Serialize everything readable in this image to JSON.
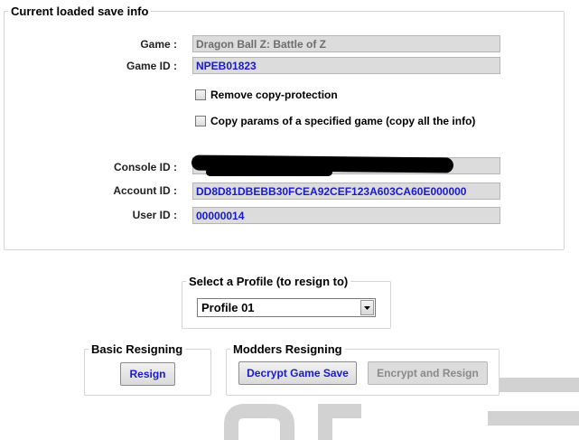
{
  "save_info": {
    "legend": "Current loaded save info",
    "game_label": "Game :",
    "game_value": "Dragon Ball Z: Battle of Z",
    "game_id_label": "Game ID :",
    "game_id_value": "NPEB01823",
    "remove_copy_protection_label": "Remove copy-protection",
    "copy_params_label": "Copy params of a specified game (copy all the info)",
    "console_id_label": "Console ID :",
    "account_id_label": "Account ID :",
    "account_id_value": "DD8D81DBEBB30FCEA92CEF123A603CA60E000000",
    "user_id_label": "User ID :",
    "user_id_value": "00000014"
  },
  "profile": {
    "legend": "Select a Profile (to resign to)",
    "selected": "Profile 01"
  },
  "basic": {
    "legend": "Basic Resigning",
    "resign_label": "Resign"
  },
  "modders": {
    "legend": "Modders Resigning",
    "decrypt_label": "Decrypt Game Save",
    "encrypt_label": "Encrypt and Resign"
  },
  "icons": {
    "dropdown": "chevron-down-icon",
    "checkbox": "checkbox-icon",
    "redaction": "redaction-mark",
    "background": "console-logo-watermark"
  },
  "colors": {
    "value_text": "#1a1acd",
    "field_bg": "#dcdcdc",
    "disabled_text": "#8a8a8a"
  }
}
